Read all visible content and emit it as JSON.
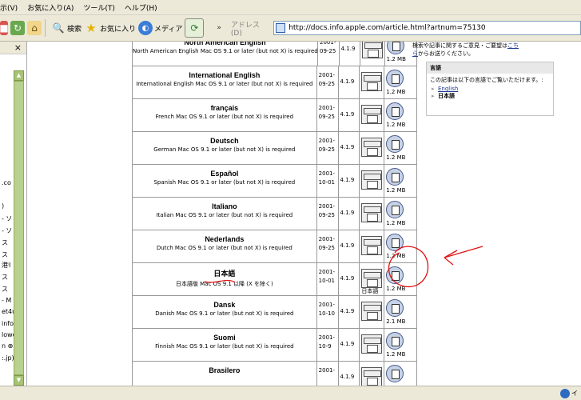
{
  "menu": [
    "示(V)",
    "お気に入り(A)",
    "ツール(T)",
    "ヘルプ(H)"
  ],
  "toolbar": {
    "search_label": "検索",
    "favorites_label": "お気に入り",
    "media_label": "メディア",
    "chevron": "»",
    "address_label": "アドレス(D)",
    "address_url": "http://docs.info.apple.com/article.html?artnum=75130"
  },
  "left_pane": {
    "close_glyph": "×",
    "fragments": [
      ".co",
      ")",
      "- ソ",
      "- ソ",
      "ス",
      "ス",
      "港ﾘ",
      "ス",
      "ス",
      "- M",
      "et4u",
      "info",
      "lowe",
      "n ⊕",
      ":.jp)"
    ]
  },
  "right_panel": {
    "intro": "検索や記事に関するご意見・ご要望は",
    "intro_link": "こち",
    "intro_link2": "ら",
    "intro_tail": "からお送りください。",
    "box_title": "言語",
    "box_text": "この記事は以下の言語でご覧いただけます。:",
    "languages": [
      "English",
      "日本語"
    ]
  },
  "table": {
    "rows": [
      {
        "title": "North American English",
        "req": "North American English Mac OS 9.1 or later (but not X) is required",
        "date1": "2001-",
        "date2": "09-25",
        "ver": "4.1.9",
        "size": "1.2 MB"
      },
      {
        "title": "International English",
        "req": "International English Mac OS 9.1 or later (but not X) is required",
        "date1": "2001-",
        "date2": "09-25",
        "ver": "4.1.9",
        "size": "1.2 MB"
      },
      {
        "title": "français",
        "req": "French Mac OS 9.1 or later (but not X) is required",
        "date1": "2001-",
        "date2": "09-25",
        "ver": "4.1.9",
        "size": "1.2 MB"
      },
      {
        "title": "Deutsch",
        "req": "German Mac OS 9.1 or later (but not X) is required",
        "date1": "2001-",
        "date2": "09-25",
        "ver": "4.1.9",
        "size": "1.2 MB"
      },
      {
        "title": "Español",
        "req": "Spanish Mac OS 9.1 or later (but not X) is required",
        "date1": "2001-",
        "date2": "10-01",
        "ver": "4.1.9",
        "size": "1.2 MB"
      },
      {
        "title": "Italiano",
        "req": "Italian Mac OS 9.1 or later (but not X) is required",
        "date1": "2001-",
        "date2": "09-25",
        "ver": "4.1.9",
        "size": "1.2 MB"
      },
      {
        "title": "Nederlands",
        "req": "Dutch Mac OS 9.1 or later (but not X) is required",
        "date1": "2001-",
        "date2": "09-25",
        "ver": "4.1.9",
        "size": "1.2 MB"
      },
      {
        "title": "日本語",
        "req": "日本語版 Mac OS 9.1 以降 (X を除く)",
        "date1": "2001-",
        "date2": "10-01",
        "ver": "4.1.9",
        "size": "1.2 MB",
        "dl_caption": "日本語"
      },
      {
        "title": "Dansk",
        "req": "Danish Mac OS 9.1 or later (but not X) is required",
        "date1": "2001-",
        "date2": "10-10",
        "ver": "4.1.9",
        "size": "2.1 MB"
      },
      {
        "title": "Suomi",
        "req": "Finnish Mac OS 9.1 or later (but not X) is required",
        "date1": "2001-",
        "date2": "10-9",
        "ver": "4.1.9",
        "size": "1.2 MB"
      },
      {
        "title": "Brasilero",
        "req": "",
        "date1": "2001-",
        "date2": "",
        "ver": "4.1.9",
        "size": ""
      }
    ]
  },
  "status": {
    "text": "イ"
  },
  "colors": {
    "annotation": "#e01010",
    "link": "#1f3a93",
    "chrome": "#ece9d8"
  }
}
